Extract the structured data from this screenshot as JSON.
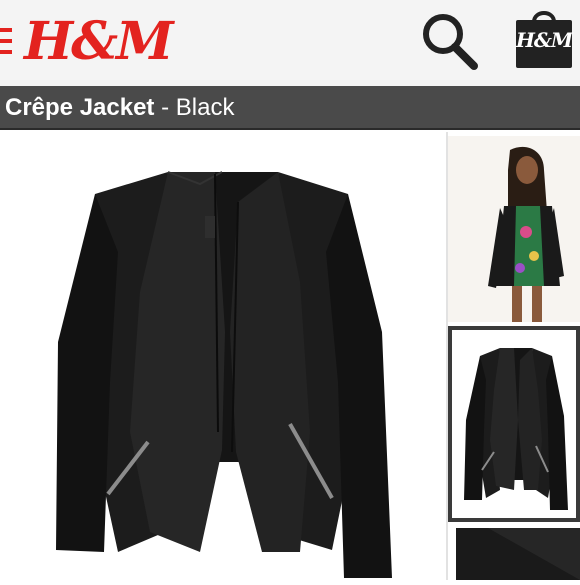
{
  "header": {
    "brand": "H&M",
    "bag_logo": "H&M",
    "icons": {
      "menu": "menu-icon",
      "search": "search-icon",
      "bag": "shopping-bag-icon"
    },
    "brand_color": "#e3231f"
  },
  "product": {
    "name": "Crêpe Jacket",
    "separator": " - ",
    "color": "Black"
  },
  "gallery": {
    "thumbnails": [
      {
        "type": "model-photo",
        "selected": false
      },
      {
        "type": "product-photo",
        "selected": true
      },
      {
        "type": "detail-photo",
        "selected": false
      }
    ]
  }
}
